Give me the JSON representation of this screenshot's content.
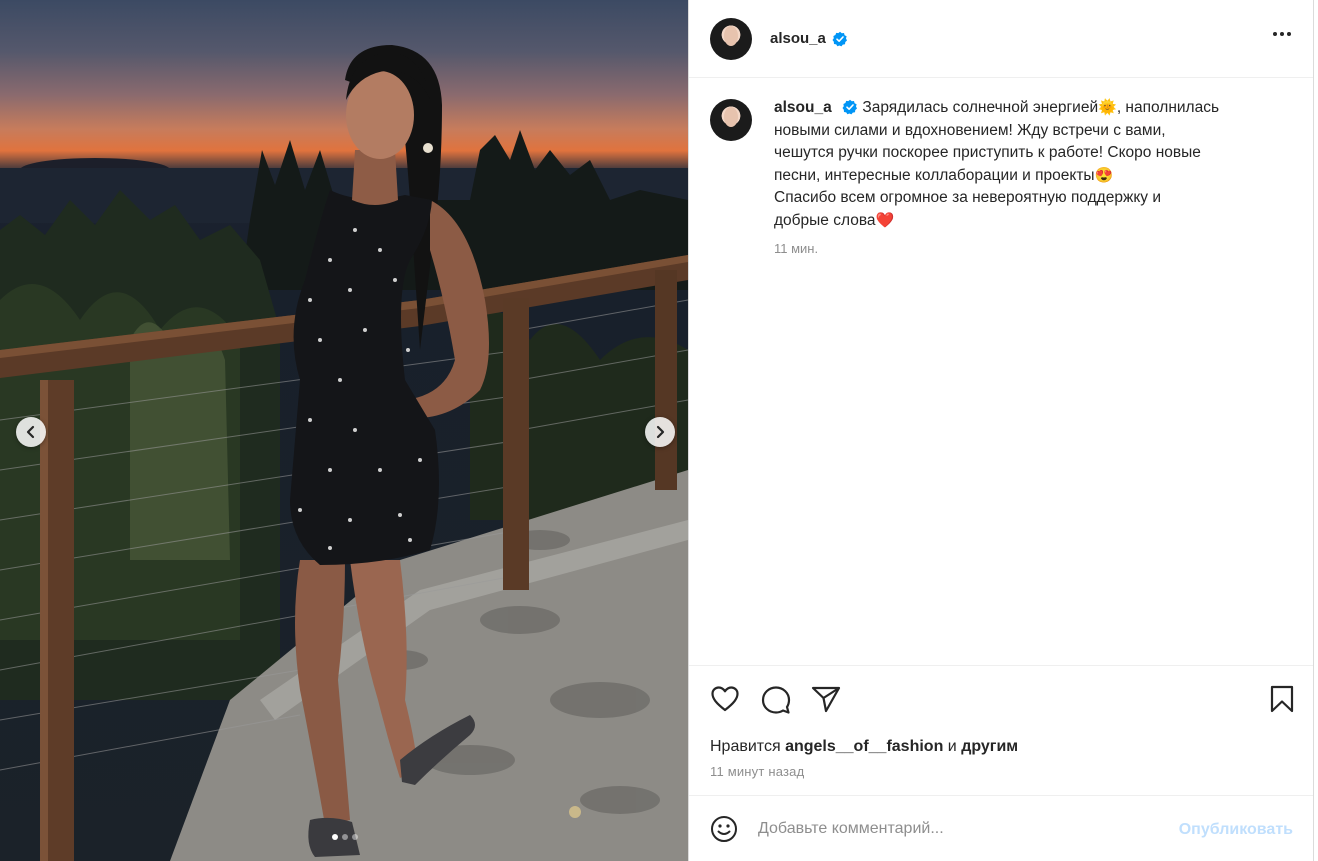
{
  "post": {
    "username": "alsou_a",
    "verified": true,
    "caption_lines": [
      "Зарядилась солнечной энергией",
      ", наполнилась",
      "новыми силами и вдохновением! Жду встречи с вами,",
      "чешутся ручки поскорее приступить к работе! Скоро новые",
      "песни, интересные коллаборации и проекты",
      "Спасибо всем огромное за невероятную поддержку и",
      "добрые слова"
    ],
    "emoji_sun": "🌞",
    "emoji_love": "😍",
    "emoji_heart": "❤️",
    "time_ago": "11 мин.",
    "likes_prefix": "Нравится",
    "likes_user": "angels__of__fashion",
    "likes_and": "и",
    "likes_others": "другим",
    "posted_ago": "11 минут назад",
    "carousel": {
      "slide_count": 3,
      "active_index": 0
    }
  },
  "comment": {
    "placeholder": "Добавьте комментарий...",
    "publish_label": "Опубликовать"
  },
  "icons": {
    "more": "more-horizontal-icon",
    "like": "heart-icon",
    "comment": "comment-bubble-icon",
    "share": "send-icon",
    "save": "bookmark-icon",
    "emoji": "emoji-smile-icon",
    "prev": "chevron-left-icon",
    "next": "chevron-right-icon",
    "verified": "verified-badge-icon"
  },
  "colors": {
    "verified_blue": "#0095f6",
    "publish_disabled": "#c0dffd",
    "muted_text": "#8e8e8e"
  }
}
